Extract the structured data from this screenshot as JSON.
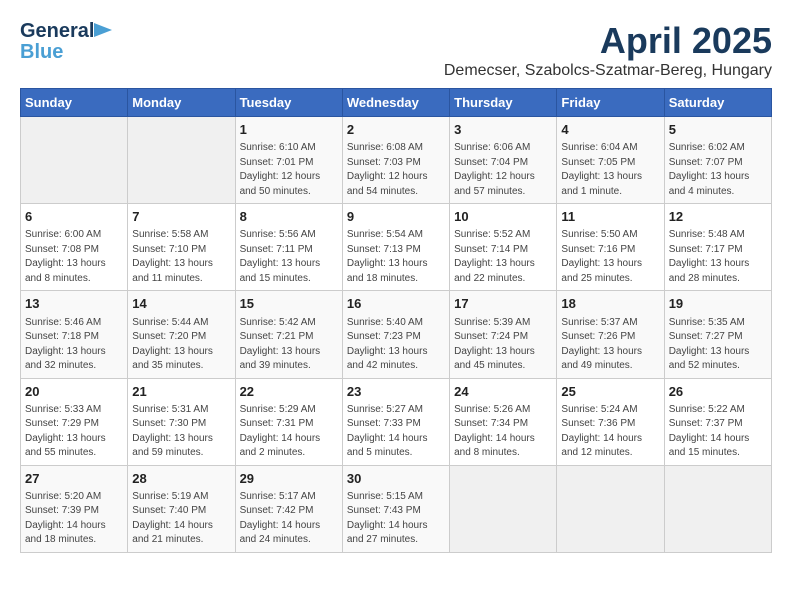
{
  "logo": {
    "line1": "General",
    "line2": "Blue"
  },
  "title": "April 2025",
  "subtitle": "Demecser, Szabolcs-Szatmar-Bereg, Hungary",
  "days_header": [
    "Sunday",
    "Monday",
    "Tuesday",
    "Wednesday",
    "Thursday",
    "Friday",
    "Saturday"
  ],
  "weeks": [
    [
      {
        "day": "",
        "info": ""
      },
      {
        "day": "",
        "info": ""
      },
      {
        "day": "1",
        "info": "Sunrise: 6:10 AM\nSunset: 7:01 PM\nDaylight: 12 hours\nand 50 minutes."
      },
      {
        "day": "2",
        "info": "Sunrise: 6:08 AM\nSunset: 7:03 PM\nDaylight: 12 hours\nand 54 minutes."
      },
      {
        "day": "3",
        "info": "Sunrise: 6:06 AM\nSunset: 7:04 PM\nDaylight: 12 hours\nand 57 minutes."
      },
      {
        "day": "4",
        "info": "Sunrise: 6:04 AM\nSunset: 7:05 PM\nDaylight: 13 hours\nand 1 minute."
      },
      {
        "day": "5",
        "info": "Sunrise: 6:02 AM\nSunset: 7:07 PM\nDaylight: 13 hours\nand 4 minutes."
      }
    ],
    [
      {
        "day": "6",
        "info": "Sunrise: 6:00 AM\nSunset: 7:08 PM\nDaylight: 13 hours\nand 8 minutes."
      },
      {
        "day": "7",
        "info": "Sunrise: 5:58 AM\nSunset: 7:10 PM\nDaylight: 13 hours\nand 11 minutes."
      },
      {
        "day": "8",
        "info": "Sunrise: 5:56 AM\nSunset: 7:11 PM\nDaylight: 13 hours\nand 15 minutes."
      },
      {
        "day": "9",
        "info": "Sunrise: 5:54 AM\nSunset: 7:13 PM\nDaylight: 13 hours\nand 18 minutes."
      },
      {
        "day": "10",
        "info": "Sunrise: 5:52 AM\nSunset: 7:14 PM\nDaylight: 13 hours\nand 22 minutes."
      },
      {
        "day": "11",
        "info": "Sunrise: 5:50 AM\nSunset: 7:16 PM\nDaylight: 13 hours\nand 25 minutes."
      },
      {
        "day": "12",
        "info": "Sunrise: 5:48 AM\nSunset: 7:17 PM\nDaylight: 13 hours\nand 28 minutes."
      }
    ],
    [
      {
        "day": "13",
        "info": "Sunrise: 5:46 AM\nSunset: 7:18 PM\nDaylight: 13 hours\nand 32 minutes."
      },
      {
        "day": "14",
        "info": "Sunrise: 5:44 AM\nSunset: 7:20 PM\nDaylight: 13 hours\nand 35 minutes."
      },
      {
        "day": "15",
        "info": "Sunrise: 5:42 AM\nSunset: 7:21 PM\nDaylight: 13 hours\nand 39 minutes."
      },
      {
        "day": "16",
        "info": "Sunrise: 5:40 AM\nSunset: 7:23 PM\nDaylight: 13 hours\nand 42 minutes."
      },
      {
        "day": "17",
        "info": "Sunrise: 5:39 AM\nSunset: 7:24 PM\nDaylight: 13 hours\nand 45 minutes."
      },
      {
        "day": "18",
        "info": "Sunrise: 5:37 AM\nSunset: 7:26 PM\nDaylight: 13 hours\nand 49 minutes."
      },
      {
        "day": "19",
        "info": "Sunrise: 5:35 AM\nSunset: 7:27 PM\nDaylight: 13 hours\nand 52 minutes."
      }
    ],
    [
      {
        "day": "20",
        "info": "Sunrise: 5:33 AM\nSunset: 7:29 PM\nDaylight: 13 hours\nand 55 minutes."
      },
      {
        "day": "21",
        "info": "Sunrise: 5:31 AM\nSunset: 7:30 PM\nDaylight: 13 hours\nand 59 minutes."
      },
      {
        "day": "22",
        "info": "Sunrise: 5:29 AM\nSunset: 7:31 PM\nDaylight: 14 hours\nand 2 minutes."
      },
      {
        "day": "23",
        "info": "Sunrise: 5:27 AM\nSunset: 7:33 PM\nDaylight: 14 hours\nand 5 minutes."
      },
      {
        "day": "24",
        "info": "Sunrise: 5:26 AM\nSunset: 7:34 PM\nDaylight: 14 hours\nand 8 minutes."
      },
      {
        "day": "25",
        "info": "Sunrise: 5:24 AM\nSunset: 7:36 PM\nDaylight: 14 hours\nand 12 minutes."
      },
      {
        "day": "26",
        "info": "Sunrise: 5:22 AM\nSunset: 7:37 PM\nDaylight: 14 hours\nand 15 minutes."
      }
    ],
    [
      {
        "day": "27",
        "info": "Sunrise: 5:20 AM\nSunset: 7:39 PM\nDaylight: 14 hours\nand 18 minutes."
      },
      {
        "day": "28",
        "info": "Sunrise: 5:19 AM\nSunset: 7:40 PM\nDaylight: 14 hours\nand 21 minutes."
      },
      {
        "day": "29",
        "info": "Sunrise: 5:17 AM\nSunset: 7:42 PM\nDaylight: 14 hours\nand 24 minutes."
      },
      {
        "day": "30",
        "info": "Sunrise: 5:15 AM\nSunset: 7:43 PM\nDaylight: 14 hours\nand 27 minutes."
      },
      {
        "day": "",
        "info": ""
      },
      {
        "day": "",
        "info": ""
      },
      {
        "day": "",
        "info": ""
      }
    ]
  ]
}
